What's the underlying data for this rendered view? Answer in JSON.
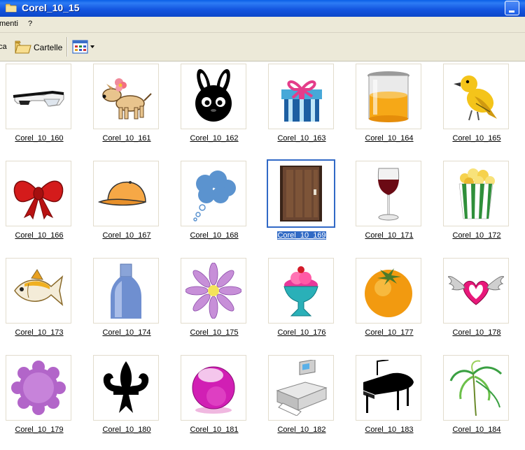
{
  "window": {
    "title": "Corel_10_15"
  },
  "menubar": {
    "items": [
      "menti",
      "?"
    ]
  },
  "toolbar": {
    "search_label": "ca",
    "folders_label": "Cartelle"
  },
  "files": [
    {
      "name": "Corel_10_160",
      "icon": "safety-glasses-icon"
    },
    {
      "name": "Corel_10_161",
      "icon": "dog-with-flower-icon"
    },
    {
      "name": "Corel_10_162",
      "icon": "black-bunny-icon"
    },
    {
      "name": "Corel_10_163",
      "icon": "gift-box-icon"
    },
    {
      "name": "Corel_10_164",
      "icon": "beaker-orange-liquid-icon"
    },
    {
      "name": "Corel_10_165",
      "icon": "yellow-bird-icon"
    },
    {
      "name": "Corel_10_166",
      "icon": "red-bow-icon"
    },
    {
      "name": "Corel_10_167",
      "icon": "orange-cap-icon"
    },
    {
      "name": "Corel_10_168",
      "icon": "thought-bubble-icon"
    },
    {
      "name": "Corel_10_169",
      "icon": "wooden-door-icon",
      "selected": true
    },
    {
      "name": "Corel_10_171",
      "icon": "wine-glass-icon"
    },
    {
      "name": "Corel_10_172",
      "icon": "popcorn-icon"
    },
    {
      "name": "Corel_10_173",
      "icon": "fish-icon"
    },
    {
      "name": "Corel_10_174",
      "icon": "blue-bottle-icon"
    },
    {
      "name": "Corel_10_175",
      "icon": "purple-flower-icon"
    },
    {
      "name": "Corel_10_176",
      "icon": "ice-cream-sundae-icon"
    },
    {
      "name": "Corel_10_177",
      "icon": "persimmon-icon"
    },
    {
      "name": "Corel_10_178",
      "icon": "winged-heart-icon"
    },
    {
      "name": "Corel_10_179",
      "icon": "purple-badge-icon"
    },
    {
      "name": "Corel_10_180",
      "icon": "fleur-de-lis-icon"
    },
    {
      "name": "Corel_10_181",
      "icon": "magenta-sphere-icon"
    },
    {
      "name": "Corel_10_182",
      "icon": "printer-icon"
    },
    {
      "name": "Corel_10_183",
      "icon": "grand-piano-icon"
    },
    {
      "name": "Corel_10_184",
      "icon": "palm-leaves-icon"
    }
  ],
  "colors": {
    "selection": "#316ac5",
    "titlebar": "#0a5fe6",
    "chrome": "#ece9d8"
  }
}
